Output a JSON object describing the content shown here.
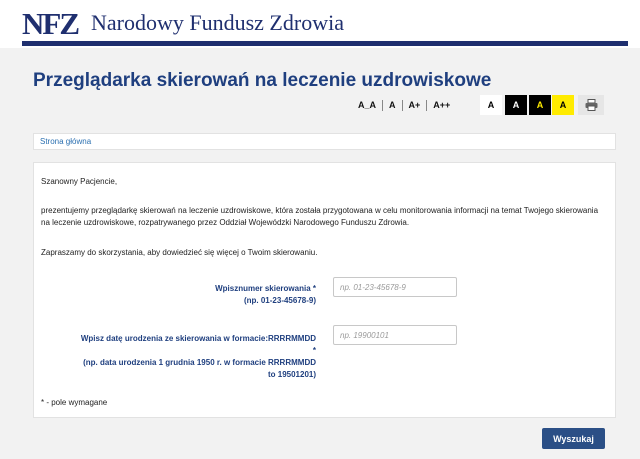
{
  "header": {
    "logo_mark": "NFZ",
    "logo_name": "Narodowy Fundusz Zdrowia",
    "brand_color": "#1f2f6f"
  },
  "page_title": "Przeglądarka skierowań na leczenie uzdrowiskowe",
  "accessibility": {
    "font_options": [
      "A_A",
      "A",
      "A+",
      "A++"
    ],
    "contrast_options": [
      {
        "label": "A",
        "scheme": "white-on-black-text"
      },
      {
        "label": "A",
        "scheme": "black-background-white-text"
      },
      {
        "label": "A",
        "scheme": "black-background-yellow-text"
      },
      {
        "label": "A",
        "scheme": "yellow-background-black-text"
      }
    ],
    "print_icon": "printer-icon"
  },
  "breadcrumb": {
    "home": "Strona główna"
  },
  "content": {
    "greeting": "Szanowny Pacjencie,",
    "intro": "prezentujemy przeglądarkę skierowań na leczenie uzdrowiskowe, która została przygotowana w celu monitorowania informacji na temat Twojego skierowania na leczenie uzdrowiskowe, rozpatrywanego przez Oddział Wojewódzki Narodowego Funduszu Zdrowia.",
    "invite": "Zapraszamy do skorzystania, aby dowiedzieć się więcej o Twoim skierowaniu."
  },
  "form": {
    "referral_label_1": "Wpisznumer skierowania *",
    "referral_label_2": "(np. 01-23-45678-9)",
    "referral_placeholder": "np. 01-23-45678-9",
    "referral_value": "",
    "birth_label_1": "Wpisz datę urodzenia ze skierowania w formacie:RRRRMMDD",
    "birth_label_2": "*",
    "birth_label_3": "(np. data urodzenia 1 grudnia 1950 r. w formacie RRRRMMDD",
    "birth_label_4": "to 19501201)",
    "birth_placeholder": "np. 19900101",
    "birth_value": "",
    "required_note": "* - pole wymagane",
    "submit_label": "Wyszukaj"
  }
}
